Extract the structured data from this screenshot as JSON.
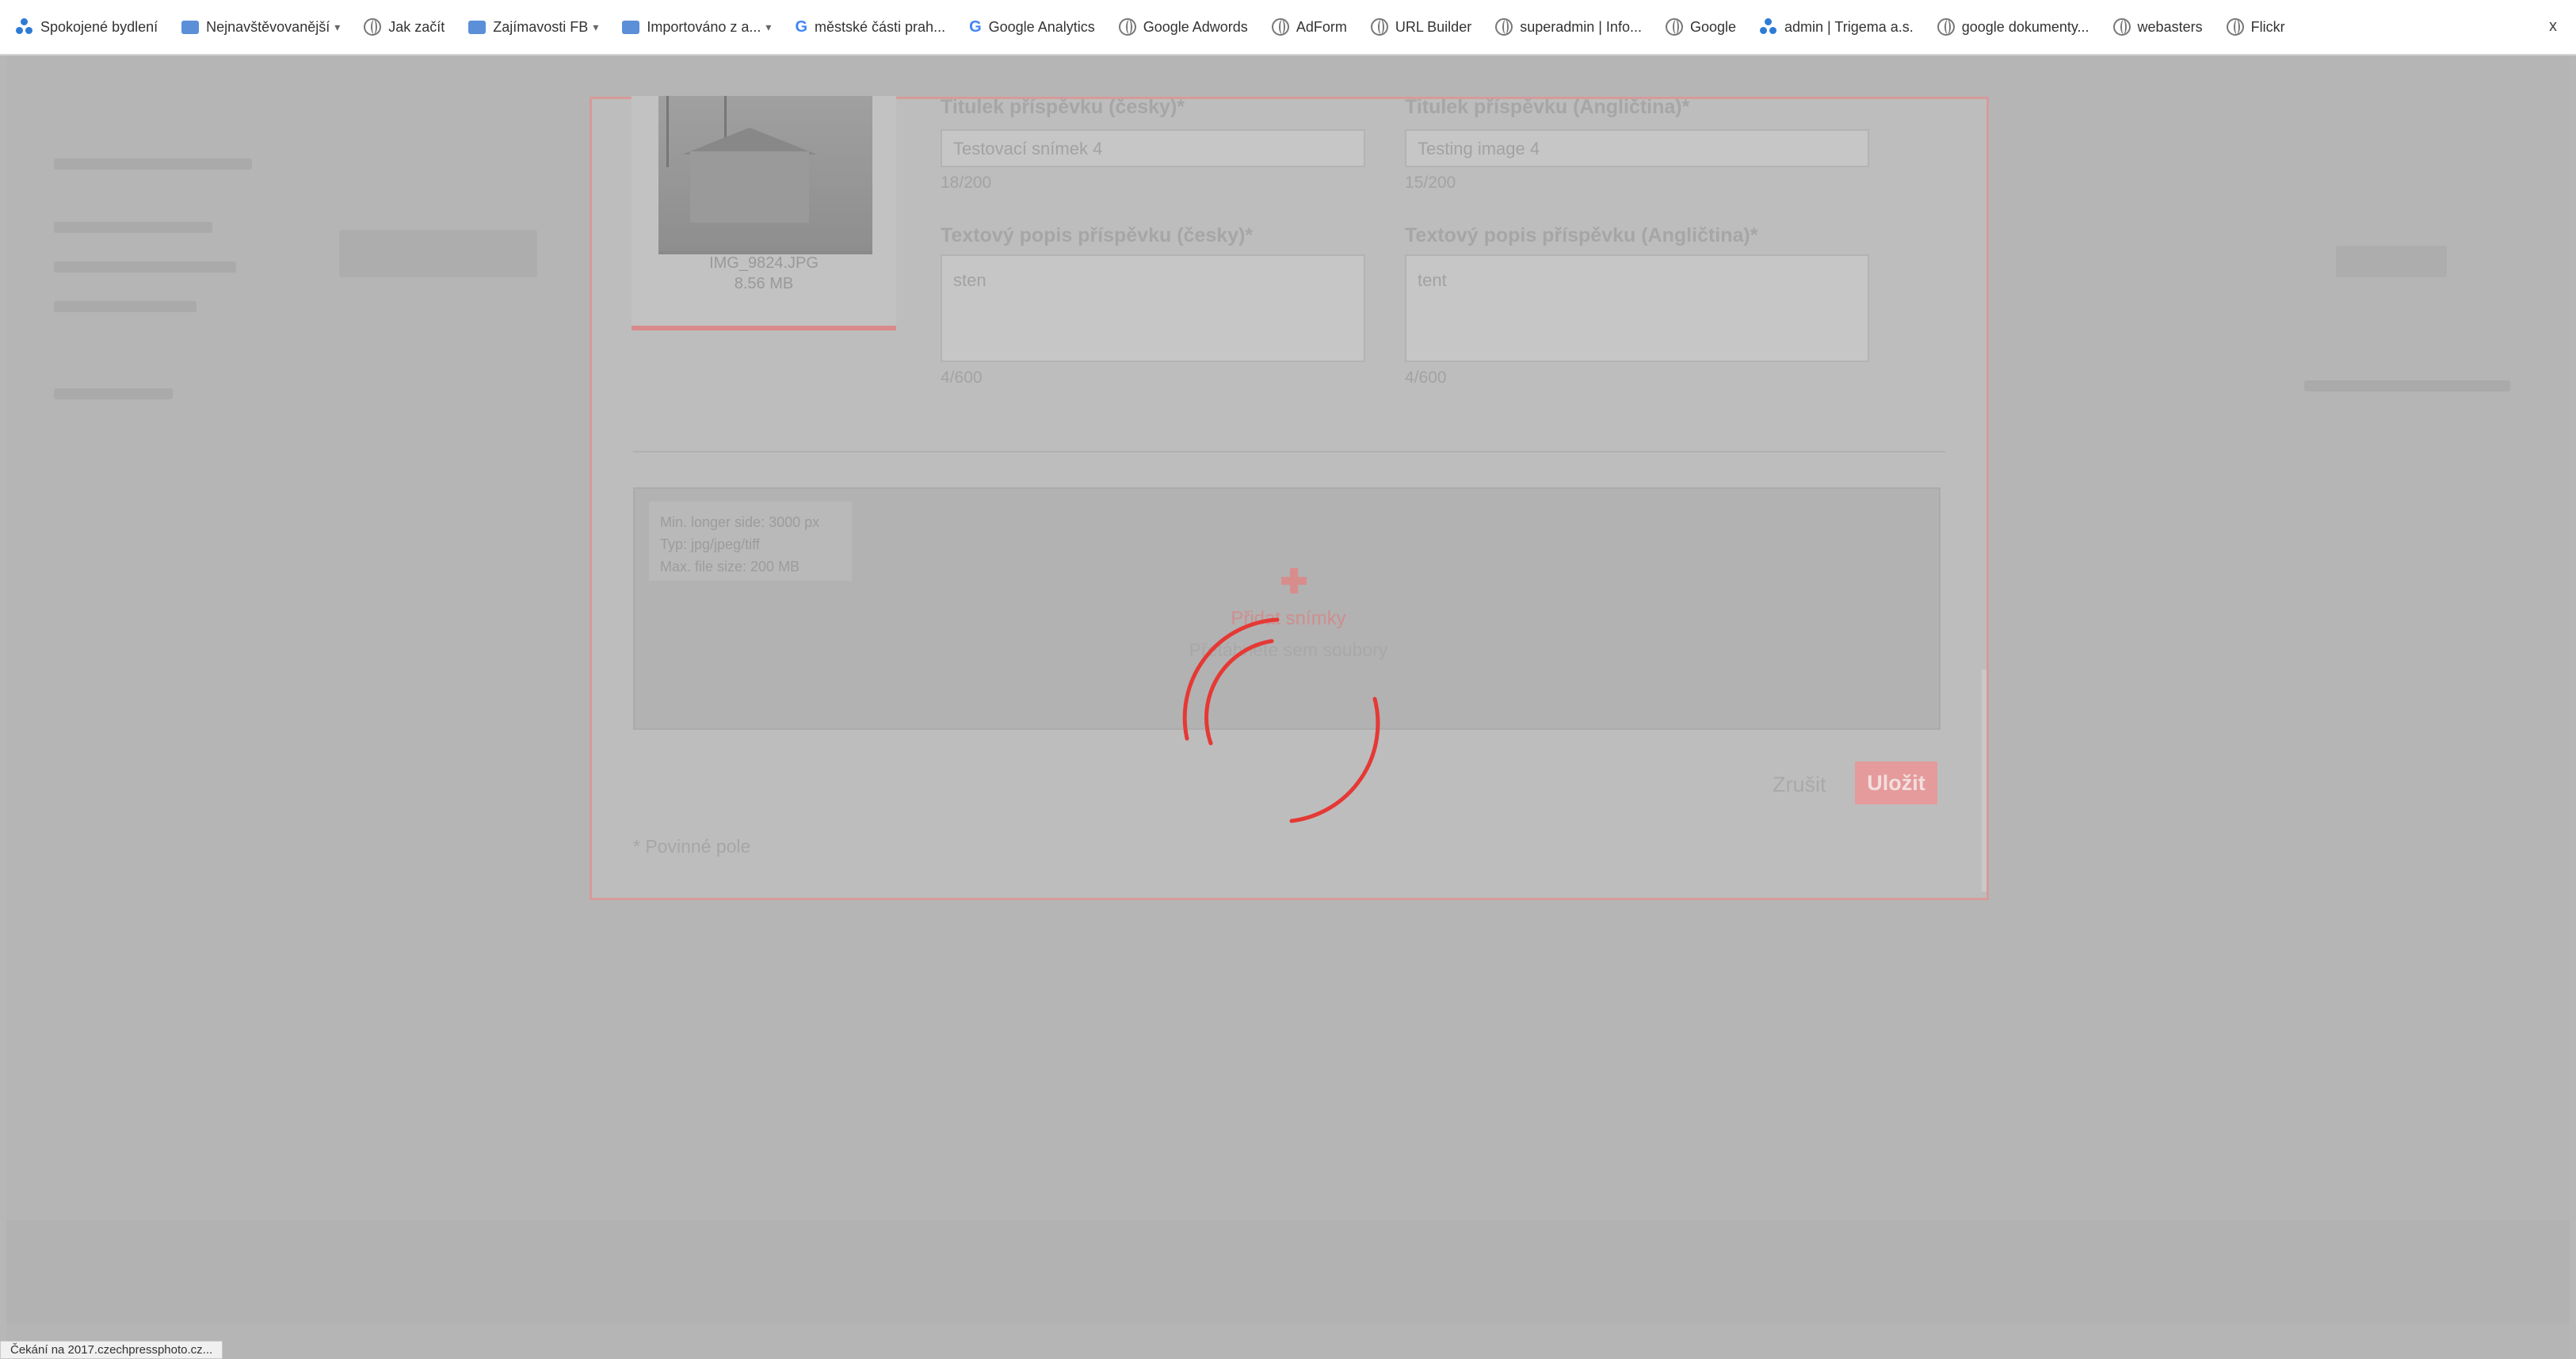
{
  "bookmarks": [
    {
      "label": "Spokojené bydlení",
      "icon": "trigema-icon",
      "folder": false
    },
    {
      "label": "Nejnavštěvovanější",
      "icon": "folder-icon",
      "folder": true
    },
    {
      "label": "Jak začít",
      "icon": "globe-icon",
      "folder": false
    },
    {
      "label": "Zajímavosti FB",
      "icon": "folder-icon",
      "folder": true
    },
    {
      "label": "Importováno z a...",
      "icon": "folder-icon",
      "folder": true
    },
    {
      "label": "městské části prah...",
      "icon": "google-icon",
      "folder": false
    },
    {
      "label": "Google Analytics",
      "icon": "google-icon",
      "folder": false
    },
    {
      "label": "Google Adwords",
      "icon": "globe-icon",
      "folder": false
    },
    {
      "label": "AdForm",
      "icon": "globe-icon",
      "folder": false
    },
    {
      "label": "URL Builder",
      "icon": "globe-icon",
      "folder": false
    },
    {
      "label": "superadmin | Info...",
      "icon": "globe-icon",
      "folder": false
    },
    {
      "label": "Google",
      "icon": "globe-icon",
      "folder": false
    },
    {
      "label": "admin | Trigema a.s.",
      "icon": "trigema-icon",
      "folder": false
    },
    {
      "label": "google dokumenty...",
      "icon": "globe-icon",
      "folder": false
    },
    {
      "label": "webasters",
      "icon": "globe-icon",
      "folder": false
    },
    {
      "label": "Flickr",
      "icon": "globe-icon",
      "folder": false
    }
  ],
  "bookmarks_close": "x",
  "modal": {
    "thumbnail": {
      "filename": "IMG_9824.JPG",
      "size": "8.56 MB"
    },
    "title_cz": {
      "label": "Titulek příspěvku (česky)*",
      "value": "Testovací snímek 4",
      "count": "18/200"
    },
    "title_en": {
      "label": "Titulek příspěvku (Angličtina)*",
      "value": "Testing image 4",
      "count": "15/200"
    },
    "desc_cz": {
      "label": "Textový popis příspěvku (česky)*",
      "value": "sten",
      "count": "4/600"
    },
    "desc_en": {
      "label": "Textový popis příspěvku (Angličtina)*",
      "value": "tent",
      "count": "4/600"
    },
    "dropzone": {
      "info": [
        "Min. longer side: 3000 px",
        "Typ: jpg/jpeg/tiff",
        "Max. file size: 200 MB"
      ],
      "title": "Přidat snímky",
      "subtitle": "Přetáhněte sem soubory"
    },
    "cancel_label": "Zrušit",
    "save_label": "Uložit",
    "required_note": "* Povinné pole"
  },
  "status_text": "Čekání na 2017.czechpressphoto.cz...",
  "colors": {
    "accent": "#e53935",
    "overlay": "#b5b5b5"
  }
}
